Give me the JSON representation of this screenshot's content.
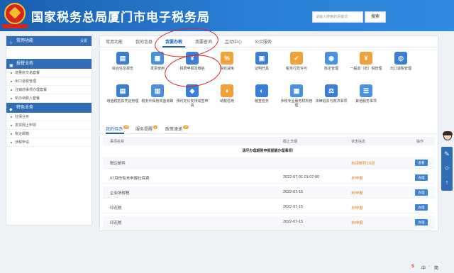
{
  "header": {
    "title": "国家税务总局厦门市电子税务局",
    "search_placeholder": "请输入搜索的关键词",
    "search_button": "搜索"
  },
  "sidebar": {
    "common": {
      "label": "常用功能",
      "action": "设置"
    },
    "section1": {
      "label": "报餐业务",
      "items": [
        "增量房交易套餐",
        "出口退税管理",
        "注销前事项办理套餐",
        "新办纳税人套餐"
      ]
    },
    "section2": {
      "label": "特色业务",
      "items": [
        "社保业务",
        "发票网上申领",
        "税企邮箱",
        "涉税申请"
      ]
    }
  },
  "tabs": [
    "常用功能",
    "我的信息",
    "我要办税",
    "我要查询",
    "互动中心",
    "公众服务"
  ],
  "tools": [
    {
      "label": "综合信息报告",
      "icon": "report-icon",
      "color": "#3a7fd5",
      "glyph": "▤"
    },
    {
      "label": "发票使用",
      "icon": "invoice-icon",
      "color": "#4a90e2",
      "glyph": "▦"
    },
    {
      "label": "税费申报及缴纳",
      "icon": "tax-declare-icon",
      "color": "#3a7fd5",
      "glyph": "¥"
    },
    {
      "label": "税收减免",
      "icon": "tax-relief-icon",
      "color": "#f0a23a",
      "glyph": "%"
    },
    {
      "label": "证明开具",
      "icon": "certificate-icon",
      "color": "#3a7fd5",
      "glyph": "▣"
    },
    {
      "label": "税务行政许可",
      "icon": "license-icon",
      "color": "#f0a23a",
      "glyph": "✓"
    },
    {
      "label": "核定管理",
      "icon": "verify-icon",
      "color": "#4a90e2",
      "glyph": "◉"
    },
    {
      "label": "一般退（抵）税管理",
      "icon": "refund-icon",
      "color": "#f0a23a",
      "glyph": "¥"
    },
    {
      "label": "出口退税管理",
      "icon": "export-refund-icon",
      "color": "#3a7fd5",
      "glyph": "◎"
    },
    {
      "label": "增值税抵扣凭证管理",
      "icon": "vat-deduct-icon",
      "color": "#3a7fd5",
      "glyph": "▤"
    },
    {
      "label": "税务代保管资金收取",
      "icon": "custody-icon",
      "color": "#4a90e2",
      "glyph": "▥"
    },
    {
      "label": "预约定价安排谈签申请",
      "icon": "pricing-icon",
      "color": "#3a7fd5",
      "glyph": "◆"
    },
    {
      "label": "纳税信用",
      "icon": "credit-icon",
      "color": "#f0a23a",
      "glyph": "♦"
    },
    {
      "label": "稽查检务",
      "icon": "inspection-icon",
      "color": "#3a7fd5",
      "glyph": "◐"
    },
    {
      "label": "涉税专业服务机构管理",
      "icon": "agency-icon",
      "color": "#4a90e2",
      "glyph": "▦"
    },
    {
      "label": "法律追责与救济事项",
      "icon": "legal-icon",
      "color": "#3a7fd5",
      "glyph": "⚖"
    },
    {
      "label": "其他服务事项",
      "icon": "other-icon",
      "color": "#4a90e2",
      "glyph": "☰"
    }
  ],
  "subtabs": [
    {
      "label": "我的待办",
      "badge": "23"
    },
    {
      "label": "服务提醒",
      "badge": "0"
    },
    {
      "label": "政策速递",
      "badge": "13"
    }
  ],
  "table": {
    "headers": [
      "事项名称",
      "截止日期",
      "状态信息",
      "操作"
    ],
    "notice": "请尽办理期限申报提醒办理事项！",
    "rows": [
      {
        "name": "税企邮件",
        "date": "",
        "status": "未读邮件10封",
        "op": "查看"
      },
      {
        "name": "07月份有未申报社保费",
        "date": "2022-07-01 01:07:00",
        "status": "未申报",
        "op": "办理"
      },
      {
        "name": "企业所得税",
        "date": "2022-07-15",
        "status": "未申报",
        "op": "办理"
      },
      {
        "name": "印花税",
        "date": "2022-07-15",
        "status": "未申报",
        "op": "办理"
      },
      {
        "name": "印花税",
        "date": "2022-07-15",
        "status": "未申报",
        "op": "办理"
      }
    ]
  },
  "rightbar": {
    "icons": [
      "chat-icon",
      "star-icon",
      "up-icon"
    ]
  },
  "taskbar": {
    "items": [
      "S",
      "中",
      "·",
      "简"
    ]
  }
}
